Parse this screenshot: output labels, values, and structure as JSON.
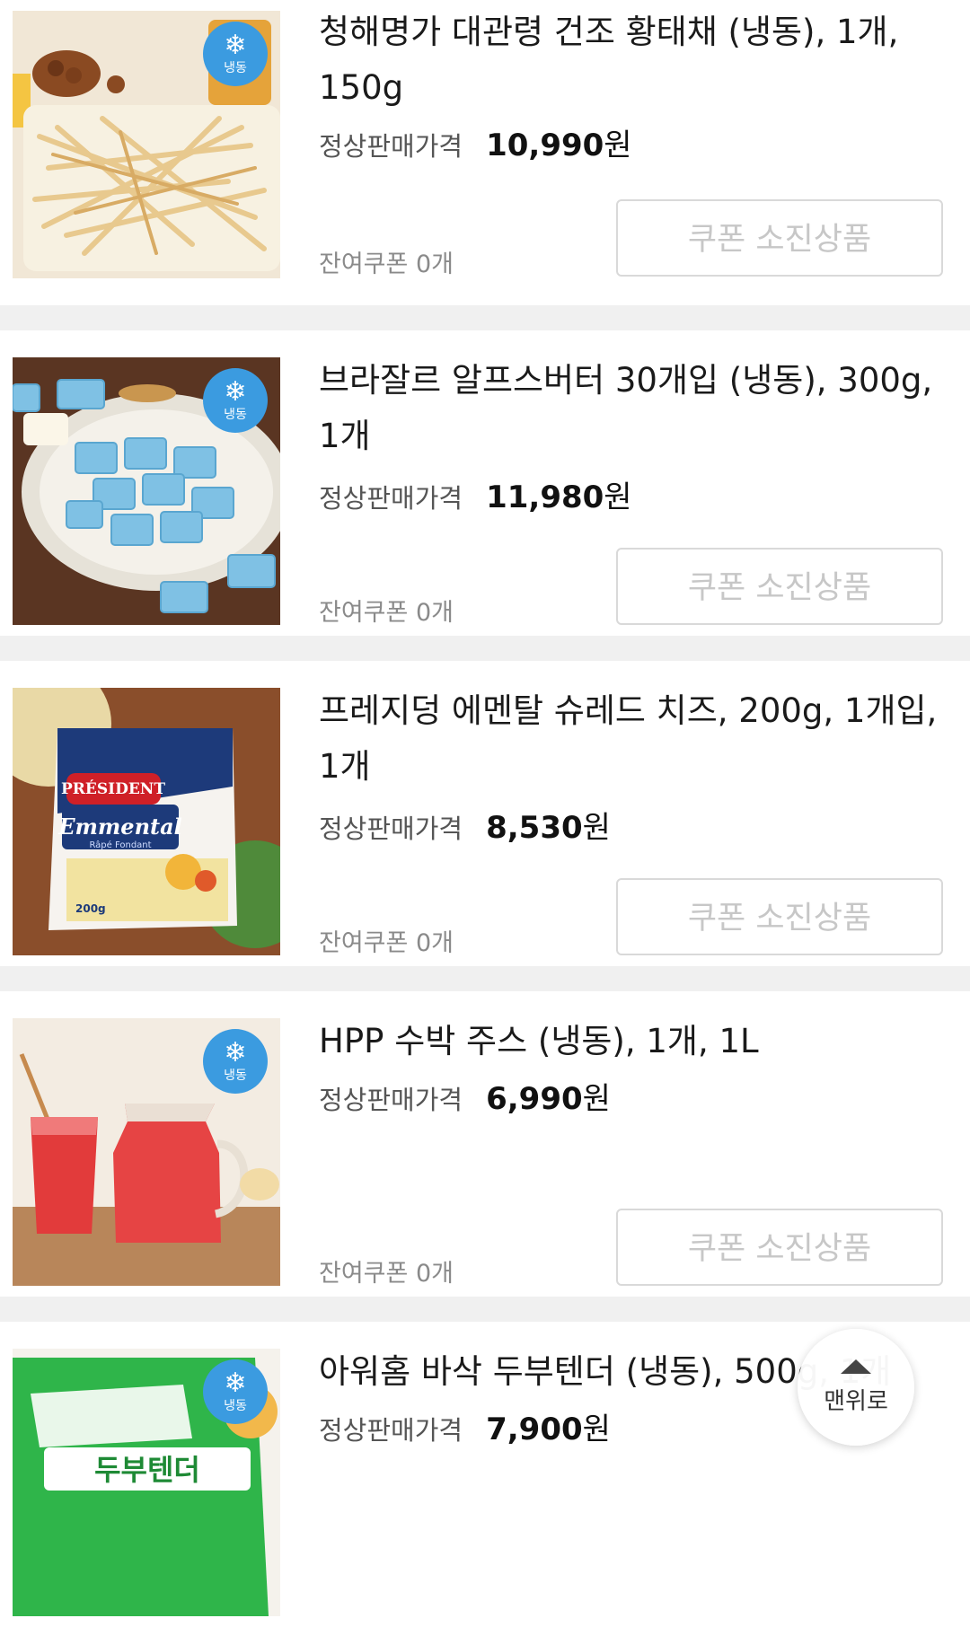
{
  "frozen_label": "냉동",
  "frozen_icon": "snowflake-icon",
  "price_label": "정상판매가격",
  "won": "원",
  "coupon_remaining": "잔여쿠폰 0개",
  "coupon_button": "쿠폰 소진상품",
  "top_button": "맨위로",
  "products": [
    {
      "title_line1": "청해명가 대관령 건조 황태채 (냉동), 1개,",
      "title_line2": "150g",
      "price": "10,990",
      "frozen": true
    },
    {
      "title_line1": "브라잘르 알프스버터 30개입 (냉동), 300g,",
      "title_line2": "1개",
      "price": "11,980",
      "frozen": true
    },
    {
      "title_line1": "프레지덩 에멘탈 슈레드 치즈, 200g, 1개입,",
      "title_line2": "1개",
      "price": "8,530",
      "frozen": false
    },
    {
      "title_line1": "HPP 수박 주스 (냉동), 1개, 1L",
      "title_line2": "",
      "price": "6,990",
      "frozen": true
    },
    {
      "title_line1": "아워홈 바삭 두부텐더 (냉동), 500g, 1개",
      "title_line2": "",
      "price": "7,900",
      "frozen": true
    }
  ],
  "package_text": {
    "cheese_brand": "PRÉSIDENT",
    "cheese_name": "Emmental",
    "cheese_sub": "Râpé Fondant",
    "cheese_weight": "200g",
    "tofu_name": "두부텐더"
  }
}
